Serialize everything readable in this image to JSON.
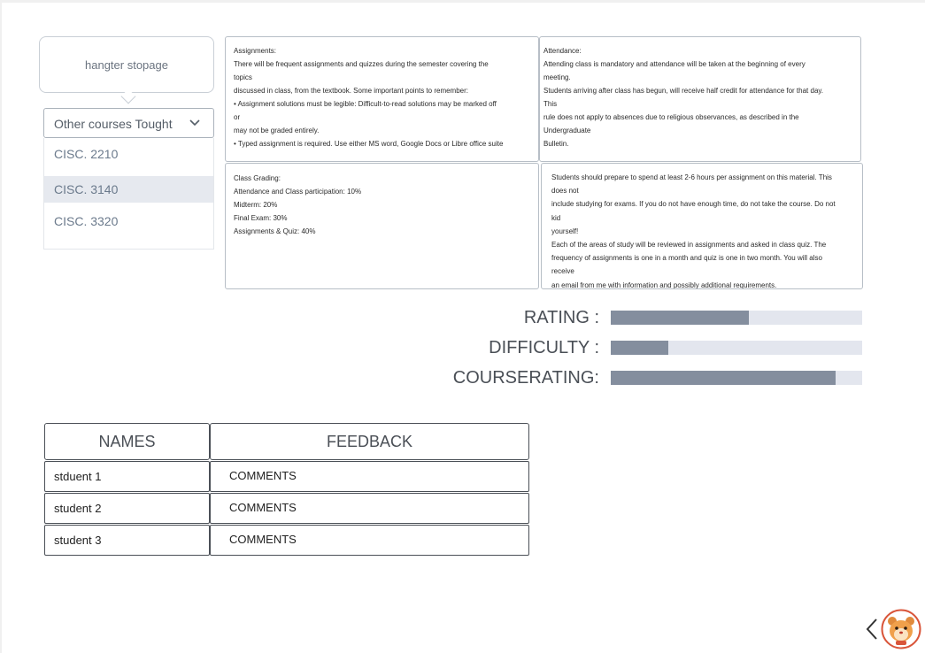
{
  "tooltip": {
    "text": "hangter stopage"
  },
  "courses_dropdown": {
    "selected_label": "Other courses Tought",
    "options": [
      "CISC. 2210",
      "CISC. 3140",
      "CISC. 3320"
    ],
    "highlighted_index": 1
  },
  "assignments_box": {
    "lines": [
      "Assignments:",
      "There will be frequent assignments and quizzes during the semester covering the",
      "topics",
      "discussed in class, from the textbook. Some important points to remember:",
      "• Assignment solutions must be legible: Difficult-to-read solutions may be marked off",
      "or",
      "may not be graded entirely.",
      "• Typed assignment is required. Use either MS word, Google Docs or Libre office suite"
    ]
  },
  "attendance_box": {
    "lines": [
      "Attendance:",
      "Attending class is mandatory and attendance will be taken at the beginning of every",
      "meeting.",
      "Students arriving after class has begun, will receive half credit for attendance for that day.",
      "This",
      "rule does not apply to absences due to religious observances, as described in the",
      "Undergraduate",
      "Bulletin."
    ]
  },
  "grading_box": {
    "lines": [
      "Class   Grading:",
      "Attendance and Class participation: 10%",
      "Midterm: 20%",
      "Final Exam: 30%",
      "Assignments & Quiz: 40%"
    ]
  },
  "study_box": {
    "lines": [
      "Students should prepare to spend at least 2-6 hours per assignment on this material. This",
      "does not",
      "include studying for exams. If you do not have enough time, do not take the course. Do not",
      "kid",
      "yourself!",
      "Each of the areas of study will be reviewed in assignments and asked in class quiz. The",
      "frequency of assignments is one in a month and quiz is one in two month. You will also",
      "receive",
      "an email from me with information and possibly additional requirements."
    ]
  },
  "ratings": [
    {
      "label": "RATING :",
      "fraction": 0.55
    },
    {
      "label": "DIFFICULTY :",
      "fraction": 0.23
    },
    {
      "label": "COURSERATING:",
      "fraction": 0.895
    }
  ],
  "feedback_table": {
    "headers": [
      "NAMES",
      "FEEDBACK"
    ],
    "rows": [
      {
        "name": "stduent 1",
        "feedback": "COMMENTS"
      },
      {
        "name": "student 2",
        "feedback": "COMMENTS"
      },
      {
        "name": "student 3",
        "feedback": "COMMENTS"
      }
    ]
  },
  "icons": {
    "back": "chevron-left-icon",
    "mascot": "hamster-avatar-icon"
  },
  "colors": {
    "bar_fill": "#848e9e",
    "bar_track": "#e3e6ee",
    "highlight": "#e6e9ef"
  }
}
